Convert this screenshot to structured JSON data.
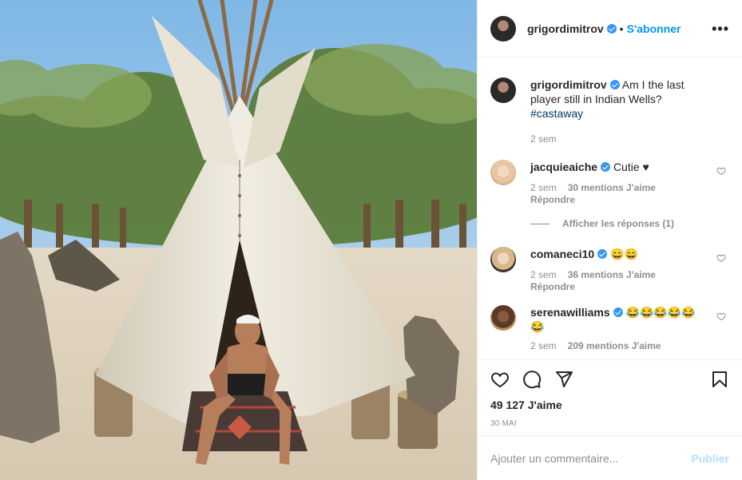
{
  "post": {
    "author": "grigordimitrov",
    "follow_label": "S'abonner",
    "more_label": "•••",
    "caption": {
      "text": "Am I the last player still in Indian Wells?",
      "hashtag": "#castaway",
      "age": "2 sem"
    },
    "comments": [
      {
        "user": "jacquieaiche",
        "verified": true,
        "text": "Cutie ♥",
        "age": "2 sem",
        "likes": "30 mentions J'aime",
        "reply": "Répondre"
      },
      {
        "user": "comaneci10",
        "verified": true,
        "text": "😄😄",
        "age": "2 sem",
        "likes": "36 mentions J'aime",
        "reply": "Répondre"
      },
      {
        "user": "serenawilliams",
        "verified": true,
        "text": "😂😂😂😂😂😂",
        "age": "2 sem",
        "likes": "209 mentions J'aime"
      }
    ],
    "view_replies": "Afficher les réponses (1)",
    "likes_count": "49 127 J'aime",
    "date": "30 MAI",
    "add_comment_placeholder": "Ajouter un commentaire...",
    "publish_label": "Publier"
  },
  "icons": {
    "like": "heart-icon",
    "comment": "comment-icon",
    "share": "paper-plane-icon",
    "save": "bookmark-icon",
    "verified": "verified-badge-icon"
  },
  "colors": {
    "accent": "#0095f6",
    "verified": "#3897f0",
    "muted": "#8e8e8e",
    "publish_disabled": "#b2dffc"
  }
}
